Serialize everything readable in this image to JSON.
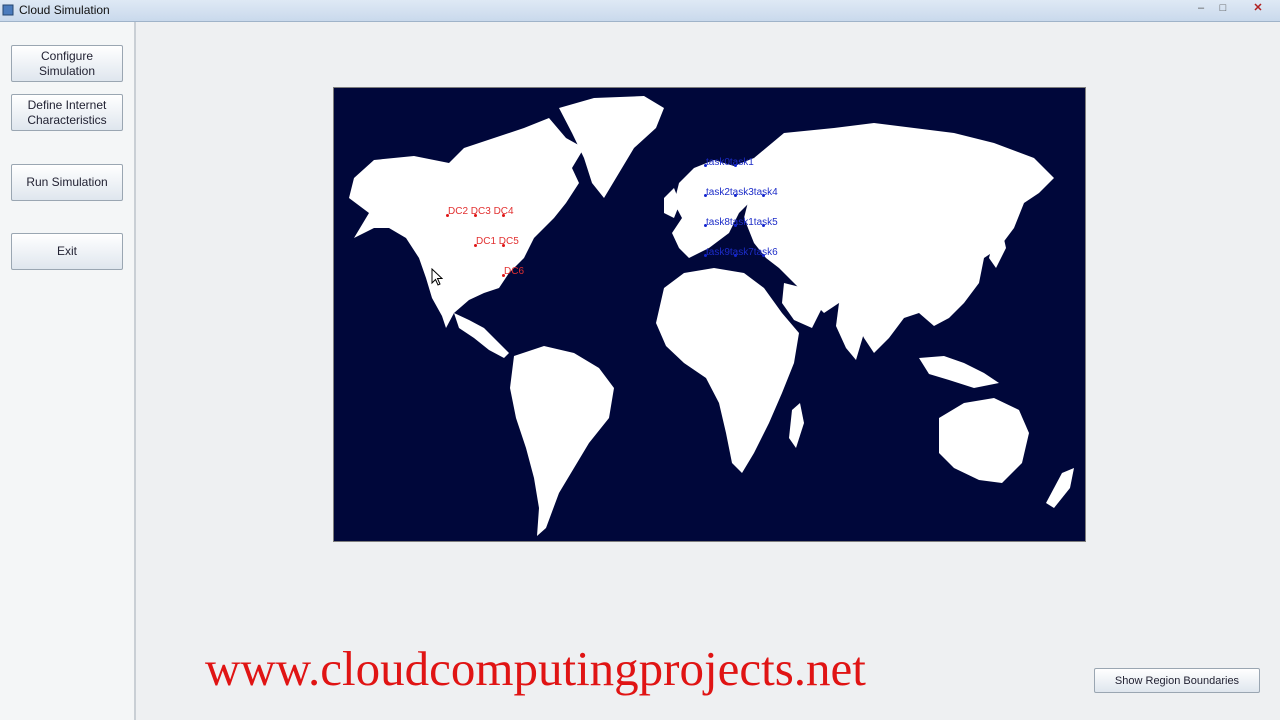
{
  "window": {
    "title": "Cloud Simulation",
    "minimize_glyph": "–",
    "maximize_glyph": "□",
    "close_glyph": "✕"
  },
  "sidebar": {
    "configure_label": "Configure Simulation",
    "define_label": "Define Internet Characteristics",
    "run_label": "Run Simulation",
    "exit_label": "Exit"
  },
  "map": {
    "background_color": "#00073a",
    "land_color": "#ffffff",
    "datacenter_color": "#e01515",
    "task_color": "#1225d0",
    "datacenter_labels": [
      "DC2 DC3 DC4",
      "DC1 DC5",
      "DC6"
    ],
    "task_labels": [
      "task0task1",
      "task2task3task4",
      "task8task1task5",
      "task9task7task6"
    ]
  },
  "footer": {
    "url_text": "www.cloudcomputingprojects.net",
    "url_color": "#e01414",
    "region_button_label": "Show Region Boundaries"
  }
}
